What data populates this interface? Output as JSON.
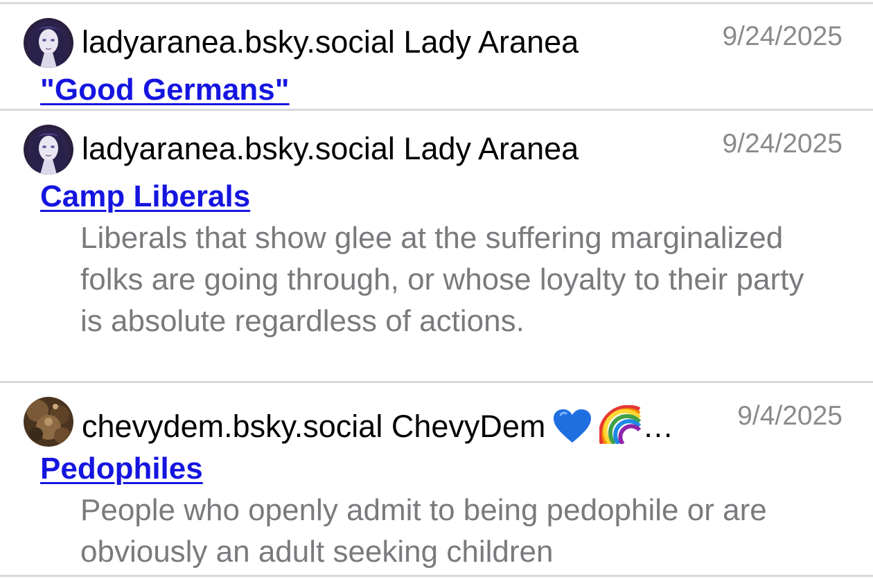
{
  "entries": [
    {
      "handle": "ladyaranea.bsky.social",
      "display_name": "Lady Aranea",
      "date": "9/24/2025",
      "title": "\"Good Germans\"",
      "description": ""
    },
    {
      "handle": "ladyaranea.bsky.social",
      "display_name": "Lady Aranea",
      "date": "9/24/2025",
      "title": "Camp Liberals",
      "description": "Liberals that show glee at the suffering marginalized folks are going through, or whose loyalty to their party is absolute regardless of actions."
    },
    {
      "handle": "chevydem.bsky.social",
      "display_name": "ChevyDem",
      "display_name_suffix": "…",
      "date": "9/4/2025",
      "title": "Pedophiles",
      "description": "People who openly admit to being pedophile or are obviously an adult seeking children"
    }
  ],
  "colors": {
    "link": "#1515e0",
    "muted": "#7a7a7e",
    "divider": "#d9d9d9"
  },
  "icons": {
    "avatar_1": "lady-aranea-avatar",
    "avatar_2": "lady-aranea-avatar",
    "avatar_3": "chevydem-avatar",
    "heart": "blue-heart-emoji",
    "rainbow": "rainbow-emoji"
  }
}
